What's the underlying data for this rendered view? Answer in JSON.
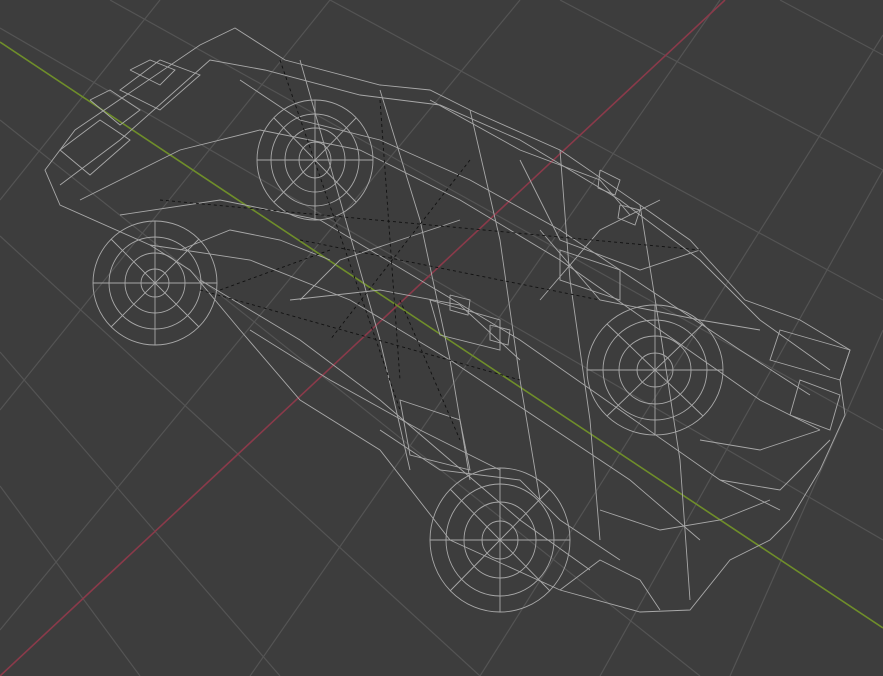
{
  "viewport": {
    "shading_mode": "wireframe",
    "object": "car",
    "colors": {
      "background": "#3d3d3d",
      "grid": "#545454",
      "x_axis": "#8a3a4a",
      "y_axis": "#6f8e2a",
      "wire": "#a8a8a8",
      "wire_dim": "#8c8c8c",
      "dashed": "#111111"
    }
  }
}
